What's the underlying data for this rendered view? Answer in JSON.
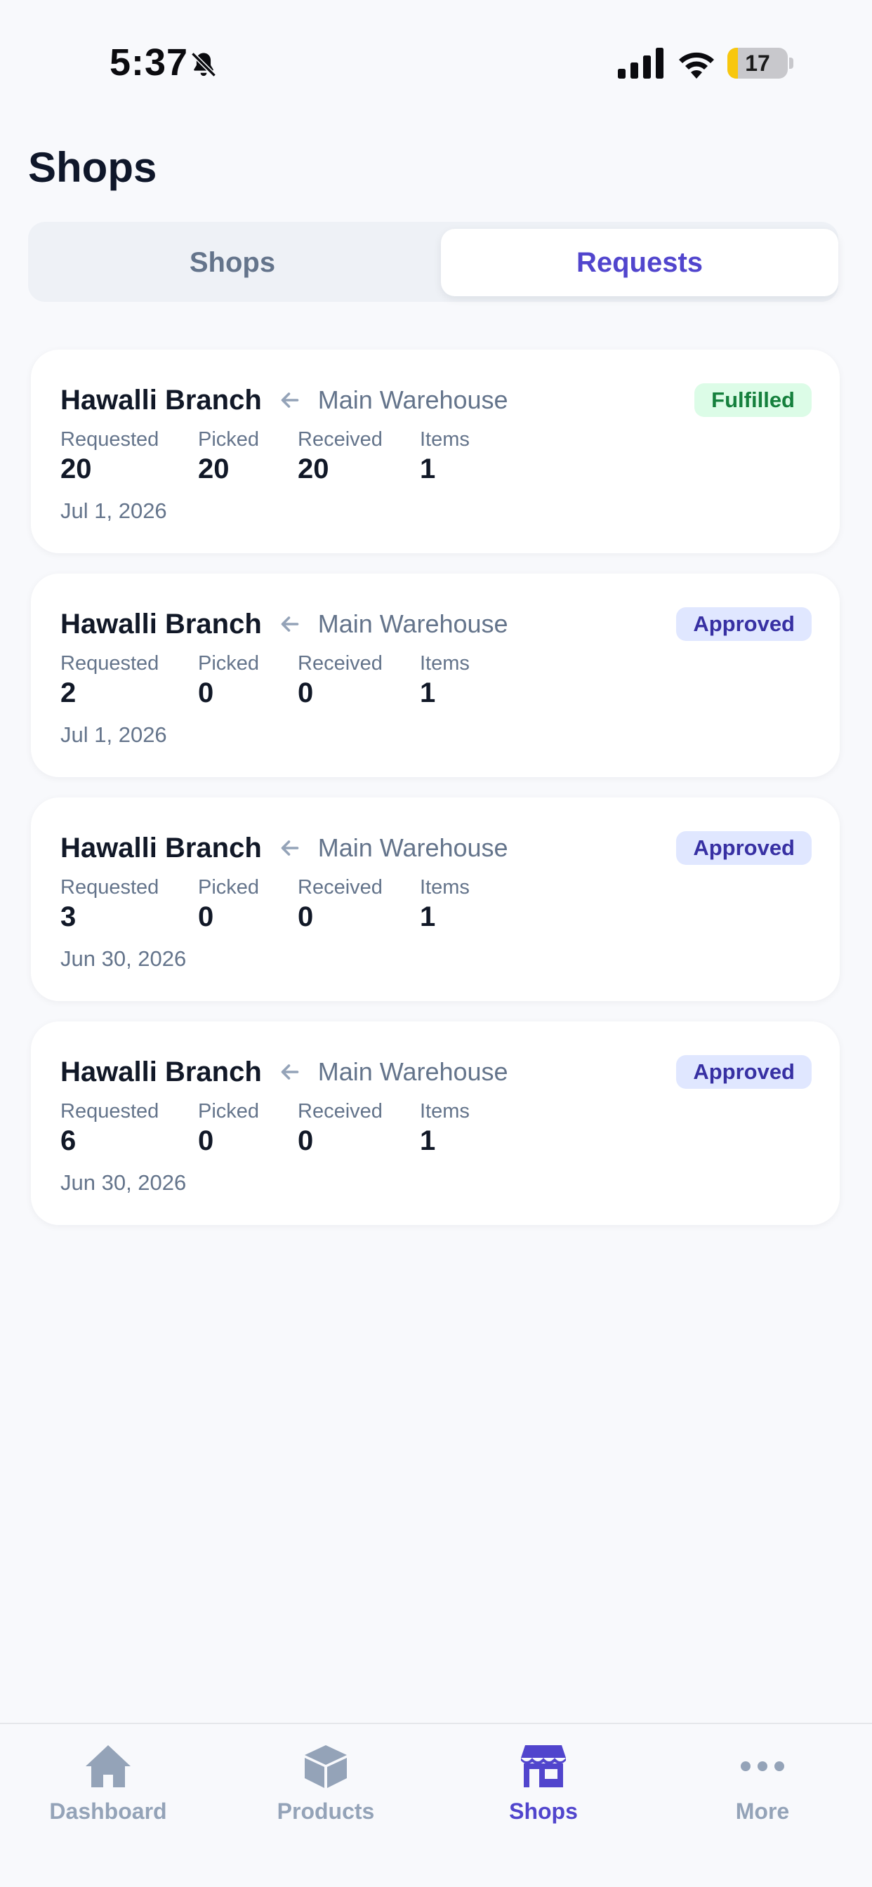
{
  "status_bar": {
    "time": "5:37",
    "battery": "17",
    "battery_level": 0.17,
    "battery_color": "#f8c70e",
    "icons": [
      "bell-slash-icon",
      "signal-icon",
      "wifi-icon",
      "battery-icon"
    ]
  },
  "header": {
    "title": "Shops"
  },
  "segments": {
    "shops": "Shops",
    "requests": "Requests",
    "active": "requests"
  },
  "requests": [
    {
      "from": "Hawalli Branch",
      "to": "Main Warehouse",
      "status": "Fulfilled",
      "stats": [
        {
          "label": "Requested",
          "value": "20"
        },
        {
          "label": "Picked",
          "value": "20"
        },
        {
          "label": "Received",
          "value": "20"
        },
        {
          "label": "Items",
          "value": "1"
        }
      ],
      "date": "Jul 1, 2026"
    },
    {
      "from": "Hawalli Branch",
      "to": "Main Warehouse",
      "status": "Approved",
      "stats": [
        {
          "label": "Requested",
          "value": "2"
        },
        {
          "label": "Picked",
          "value": "0"
        },
        {
          "label": "Received",
          "value": "0"
        },
        {
          "label": "Items",
          "value": "1"
        }
      ],
      "date": "Jul 1, 2026"
    },
    {
      "from": "Hawalli Branch",
      "to": "Main Warehouse",
      "status": "Approved",
      "stats": [
        {
          "label": "Requested",
          "value": "3"
        },
        {
          "label": "Picked",
          "value": "0"
        },
        {
          "label": "Received",
          "value": "0"
        },
        {
          "label": "Items",
          "value": "1"
        }
      ],
      "date": "Jun 30, 2026"
    },
    {
      "from": "Hawalli Branch",
      "to": "Main Warehouse",
      "status": "Approved",
      "stats": [
        {
          "label": "Requested",
          "value": "6"
        },
        {
          "label": "Picked",
          "value": "0"
        },
        {
          "label": "Received",
          "value": "0"
        },
        {
          "label": "Items",
          "value": "1"
        }
      ],
      "date": "Jun 30, 2026"
    }
  ],
  "tab_bar": {
    "items": [
      {
        "label": "Dashboard",
        "icon": "home-icon",
        "active": false
      },
      {
        "label": "Products",
        "icon": "box-icon",
        "active": false
      },
      {
        "label": "Shops",
        "icon": "store-icon",
        "active": true
      },
      {
        "label": "More",
        "icon": "more-dots-icon",
        "active": false
      }
    ]
  },
  "colors": {
    "accent": "#5145cd",
    "fulfilled_bg": "#dcfce7",
    "fulfilled_text": "#15803d",
    "approved_bg": "#e0e7ff",
    "approved_text": "#3730a3",
    "inactive": "#94a3b8"
  }
}
